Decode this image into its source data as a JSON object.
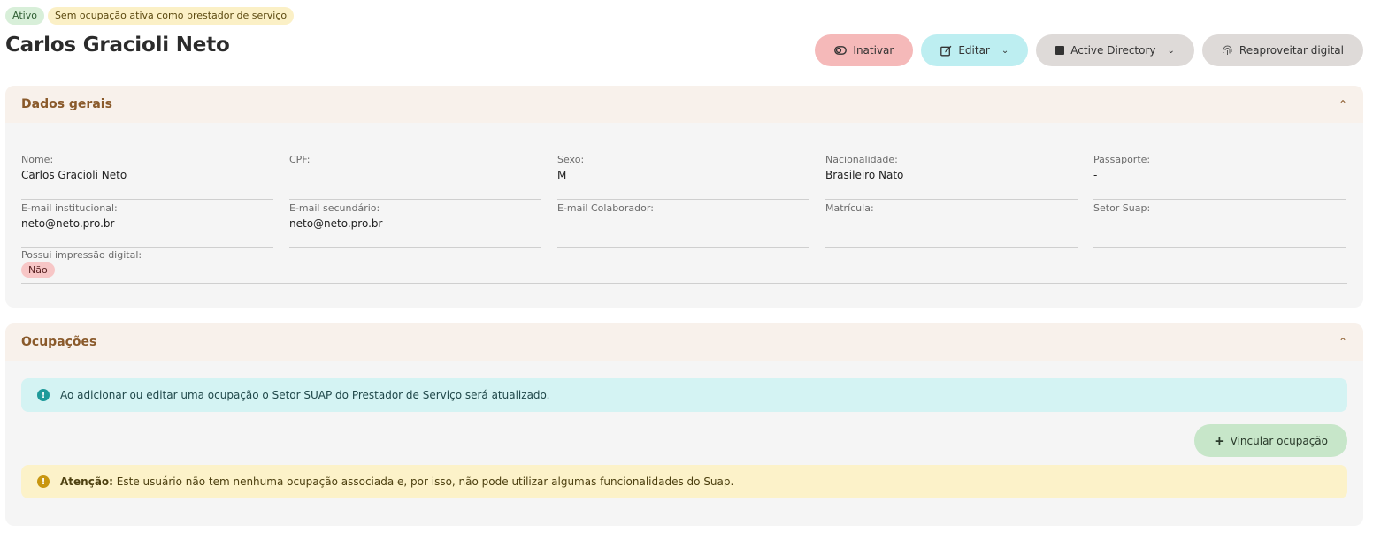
{
  "status": {
    "active_label": "Ativo",
    "occupation_label": "Sem ocupação ativa como prestador de serviço"
  },
  "person": {
    "name": "Carlos Gracioli Neto"
  },
  "actions": {
    "deactivate": "Inativar",
    "edit": "Editar",
    "active_directory": "Active Directory",
    "reuse_fingerprint": "Reaproveitar digital"
  },
  "general": {
    "title": "Dados gerais",
    "fields": [
      {
        "label": "Nome:",
        "value": "Carlos Gracioli Neto"
      },
      {
        "label": "CPF:",
        "value": ""
      },
      {
        "label": "Sexo:",
        "value": "M"
      },
      {
        "label": "Nacionalidade:",
        "value": "Brasileiro Nato"
      },
      {
        "label": "Passaporte:",
        "value": "-"
      },
      {
        "label": "E-mail institucional:",
        "value": "neto@neto.pro.br"
      },
      {
        "label": "E-mail secundário:",
        "value": "neto@neto.pro.br"
      },
      {
        "label": "E-mail Colaborador:",
        "value": ""
      },
      {
        "label": "Matrícula:",
        "value": ""
      },
      {
        "label": "Setor Suap:",
        "value": "-"
      }
    ],
    "fingerprint": {
      "label": "Possui impressão digital:",
      "value": "Não"
    }
  },
  "occupations": {
    "title": "Ocupações",
    "info_text": "Ao adicionar ou editar uma ocupação o Setor SUAP do Prestador de Serviço será atualizado.",
    "add_button": "Vincular ocupação",
    "warning_strong": "Atenção:",
    "warning_text": " Este usuário não tem nenhuma ocupação associada e, por isso, não pode utilizar algumas funcionalidades do Suap."
  },
  "colors": {
    "accent_brown": "#8a5a2b",
    "danger": "#f5b9b9",
    "info": "#bdeef1",
    "success": "#c7e6c9"
  },
  "icons": {
    "deactivate": "toggle-icon",
    "edit": "edit-icon",
    "active_directory": "square-icon",
    "reuse_fingerprint": "fingerprint-icon",
    "collapse": "chevron-up-icon",
    "info": "info-circle-icon",
    "warning": "warning-circle-icon",
    "add": "plus-icon"
  }
}
